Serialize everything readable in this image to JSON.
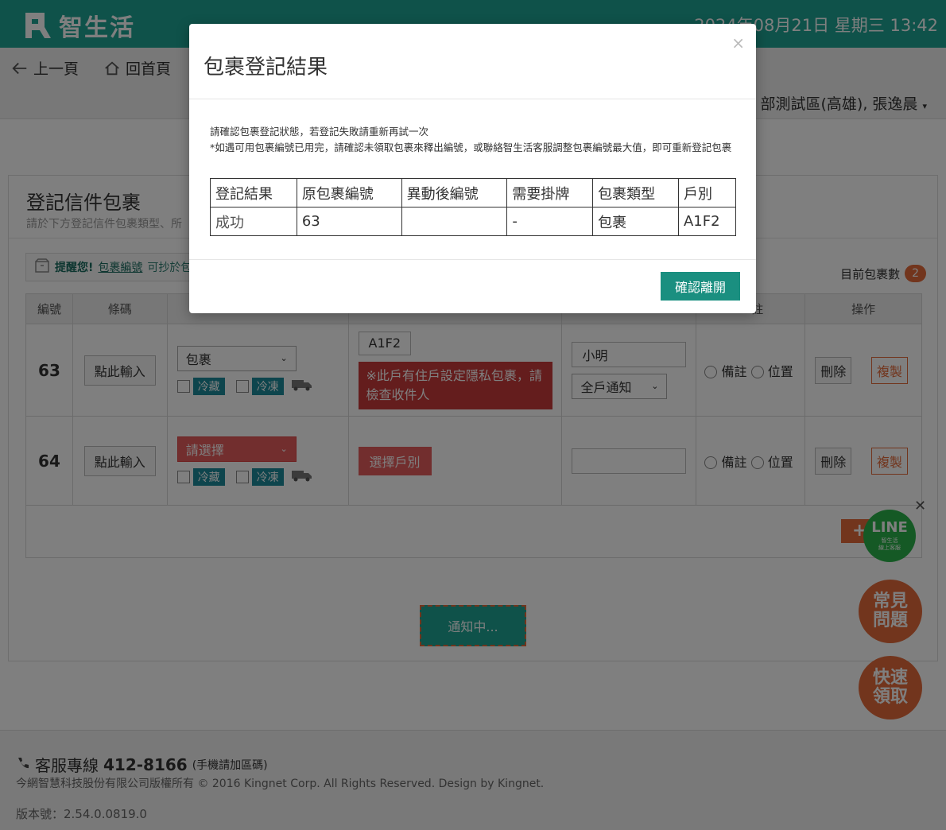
{
  "header": {
    "app_name": "智生活",
    "datetime": "2024年08月21日 星期三 13:42"
  },
  "nav": {
    "back_label": "上一頁",
    "home_label": "回首頁",
    "user": "部測試區(高雄), 張逸晨"
  },
  "page": {
    "title": "登記信件包裹",
    "subtitle": "請於下方登記信件包裹類型、所",
    "reminder_bold": "提醒您!",
    "reminder_link": "包裹編號",
    "reminder_rest": "可抄於包",
    "count_label": "目前包裹數",
    "count_value": "2"
  },
  "table": {
    "headers": [
      "編號",
      "條碼",
      "",
      "",
      "",
      "註",
      "操作"
    ],
    "scan_label": "點此輸入",
    "cold_label": "冷藏",
    "frozen_label": "冷凍",
    "note_label": "備註",
    "pos_label": "位置",
    "delete_label": "刪除",
    "copy_label": "複製",
    "rows": [
      {
        "num": "63",
        "type": "包裹",
        "household": "A1F2",
        "warning": "※此戶有住戶設定隱私包裹，請檢查收件人",
        "recipient": "小明",
        "notify": "全戶通知"
      },
      {
        "num": "64",
        "type": "請選擇",
        "pick_household": "選擇戶別",
        "recipient": ""
      }
    ]
  },
  "add_label": "+",
  "notify_label": "通知中...",
  "fab": {
    "line": "LINE",
    "line_sub": "智生活\n線上客服",
    "faq": "常見\n問題",
    "quick": "快速\n領取"
  },
  "footer": {
    "hotline_label": "客服專線",
    "hotline_number": "412-8166",
    "hotline_note": "(手機請加區碼)",
    "copyright": "今網智慧科技股份有限公司版權所有 © 2016 Kingnet Corp. All Rights Reserved. Design by Kingnet.",
    "version": "版本號：2.54.0.0819.0"
  },
  "modal": {
    "title": "包裹登記結果",
    "close": "×",
    "line1": "請確認包裹登記狀態，若登記失敗請重新再試一次",
    "line2": "*如遇可用包裹編號已用完，請確認未領取包裹來釋出編號，或聯絡智生活客服調整包裹編號最大值，即可重新登記包裹",
    "headers": [
      "登記結果",
      "原包裹編號",
      "異動後編號",
      "需要掛牌",
      "包裹類型",
      "戶別"
    ],
    "row": [
      "成功",
      "63",
      "",
      "-",
      "包裹",
      "A1F2"
    ],
    "confirm_label": "確認離開"
  },
  "colors": {
    "brand": "#1fa594",
    "accent": "#e56b3a",
    "danger": "#c83a3a"
  }
}
